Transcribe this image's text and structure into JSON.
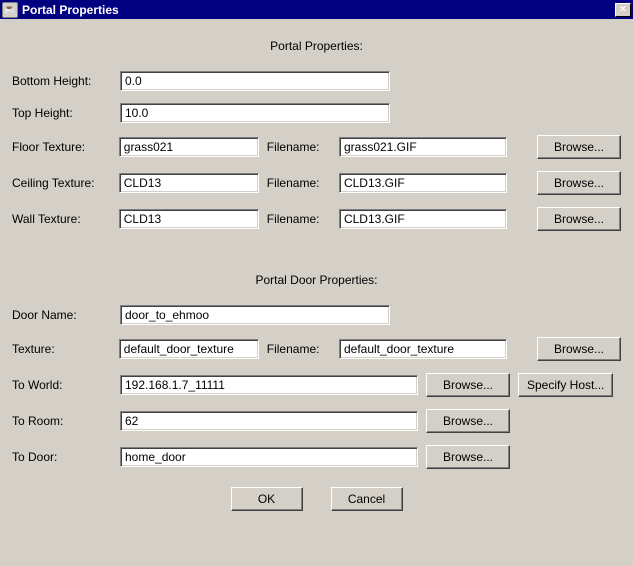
{
  "window": {
    "title": "Portal Properties",
    "close_symbol": "×",
    "icon_glyph": "☕"
  },
  "section1_title": "Portal Properties:",
  "section2_title": "Portal Door Properties:",
  "labels": {
    "bottom_height": "Bottom Height:",
    "top_height": "Top Height:",
    "floor_texture": "Floor Texture:",
    "ceiling_texture": "Ceiling Texture:",
    "wall_texture": "Wall Texture:",
    "filename": "Filename:",
    "door_name": "Door Name:",
    "texture": "Texture:",
    "to_world": "To World:",
    "to_room": "To Room:",
    "to_door": "To Door:"
  },
  "values": {
    "bottom_height": "0.0",
    "top_height": "10.0",
    "floor_texture": "grass021",
    "floor_filename": "grass021.GIF",
    "ceiling_texture": "CLD13",
    "ceiling_filename": "CLD13.GIF",
    "wall_texture": "CLD13",
    "wall_filename": "CLD13.GIF",
    "door_name": "door_to_ehmoo",
    "door_texture": "default_door_texture",
    "door_filename": "default_door_texture",
    "to_world": "192.168.1.7_11111",
    "to_room": "62",
    "to_door": "home_door"
  },
  "buttons": {
    "browse": "Browse...",
    "specify_host": "Specify Host...",
    "ok": "OK",
    "cancel": "Cancel"
  }
}
